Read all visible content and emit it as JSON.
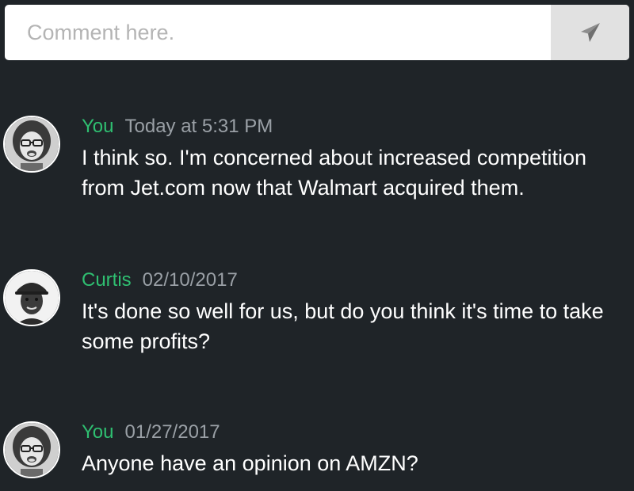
{
  "composer": {
    "placeholder": "Comment here.",
    "send_icon": "paper-plane-icon"
  },
  "messages": [
    {
      "author": "You",
      "timestamp": "Today at 5:31 PM",
      "text": "I think so. I'm concerned about increased competition from Jet.com now that Walmart acquired them.",
      "avatar": "avatar-woman-glasses"
    },
    {
      "author": "Curtis",
      "timestamp": "02/10/2017",
      "text": "It's done so well for us, but do you think it's time to take some profits?",
      "avatar": "avatar-man-cap"
    },
    {
      "author": "You",
      "timestamp": "01/27/2017",
      "text": "Anyone have an opinion on AMZN?",
      "avatar": "avatar-woman-glasses"
    }
  ],
  "colors": {
    "background": "#1f2428",
    "author": "#2fbf71",
    "timestamp": "#9aa0a6",
    "text": "#ffffff",
    "send_button": "#e1e1e1"
  }
}
